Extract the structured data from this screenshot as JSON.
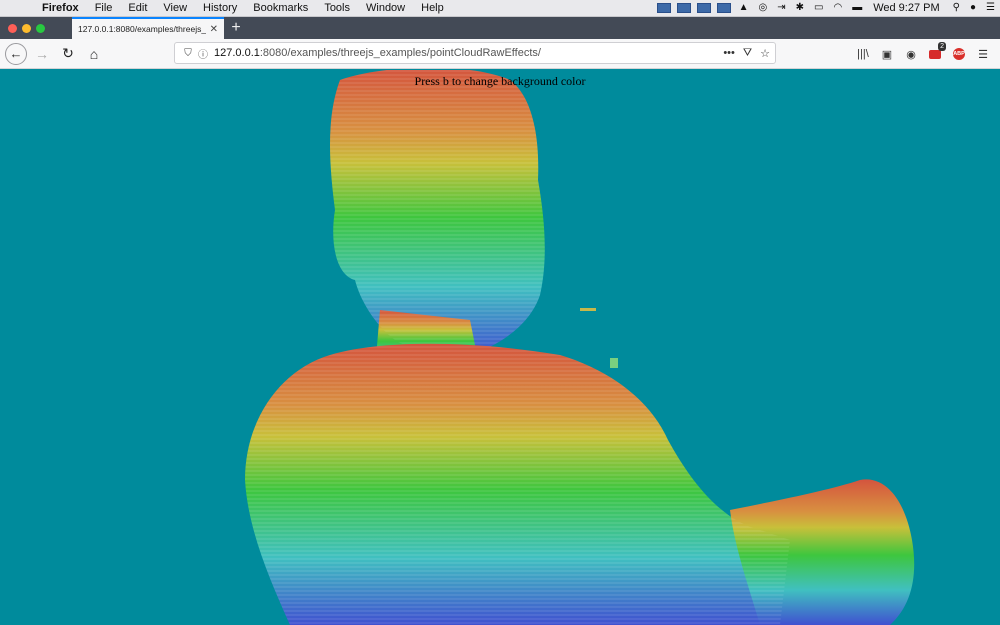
{
  "menubar": {
    "app_name": "Firefox",
    "items": [
      "File",
      "Edit",
      "View",
      "History",
      "Bookmarks",
      "Tools",
      "Window",
      "Help"
    ],
    "clock": "Wed 9:27 PM"
  },
  "tab": {
    "title": "127.0.0.1:8080/examples/threejs_examples/pointCloudRawEffects/"
  },
  "address_bar": {
    "host": "127.0.0.1",
    "path": ":8080/examples/threejs_examples/pointCloudRawEffects/"
  },
  "extensions": {
    "notification_count": "2",
    "abp_label": "ABP"
  },
  "page": {
    "hint_text": "Press b to change background color",
    "background_color": "#008b9c"
  },
  "colors": {
    "tab_accent": "#0a84ff",
    "gradient_top": "#d4543e",
    "gradient_mid_yellow": "#c8c03a",
    "gradient_mid_green": "#3ec63e",
    "gradient_cyan": "#40c0c0",
    "gradient_bottom": "#4050d0"
  }
}
